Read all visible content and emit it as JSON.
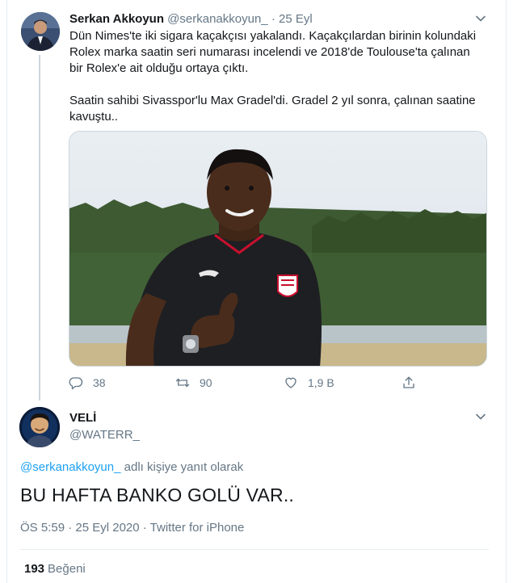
{
  "first_tweet": {
    "display_name": "Serkan Akkoyun",
    "handle": "@serkanakkoyun_",
    "separator": "·",
    "date": "25 Eyl",
    "text": "Dün Nimes'te iki sigara kaçakçısı yakalandı. Kaçakçılardan birinin kolundaki Rolex marka saatin seri numarası incelendi ve 2018'de Toulouse'ta çalınan bir Rolex'e ait olduğu ortaya çıktı.\n\nSaatin sahibi Sivasspor'lu Max Gradel'di. Gradel 2 yıl sonra, çalınan saatine kavuştu..",
    "actions": {
      "replies": "38",
      "retweets": "90",
      "likes": "1,9 B"
    }
  },
  "reply_tweet": {
    "display_name": "VELİ",
    "handle": "@WATERR_",
    "replying_mention": "@serkanakkoyun_",
    "replying_suffix": " adlı kişiye yanıt olarak",
    "text": "BU HAFTA BANKO GOLÜ VAR..",
    "meta": "ÖS 5:59 · 25 Eyl 2020 · Twitter for iPhone",
    "like_count": "193",
    "like_label": "Beğeni"
  },
  "icons": {
    "menu": "chevron-down-icon",
    "reply": "reply-icon",
    "retweet": "retweet-icon",
    "like": "heart-icon",
    "share": "share-icon"
  },
  "colors": {
    "accent": "#1da1f2",
    "secondary_text": "#657786",
    "primary_text": "#14171a",
    "border": "#e6ecf0"
  }
}
